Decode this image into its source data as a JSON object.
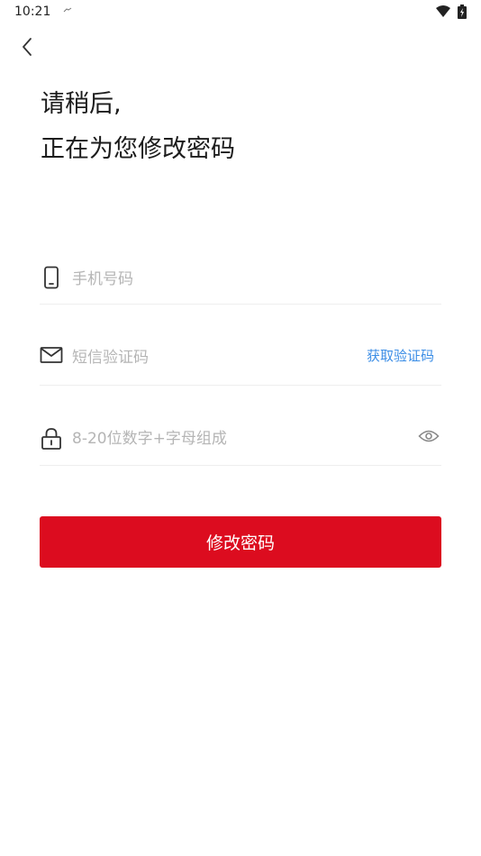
{
  "status_bar": {
    "time": "10:21"
  },
  "header": {
    "title_line1": "请稍后,",
    "title_line2": "正在为您修改密码"
  },
  "form": {
    "phone_placeholder": "手机号码",
    "sms_placeholder": "短信验证码",
    "get_code_label": "获取验证码",
    "password_placeholder": "8-20位数字+字母组成",
    "submit_label": "修改密码"
  },
  "colors": {
    "primary": "#dc0c1f",
    "link": "#3c8ee6",
    "placeholder": "#b5b5b5",
    "divider": "#eeeeee"
  },
  "icons": {
    "back": "chevron-left-icon",
    "phone": "phone-icon",
    "sms": "envelope-icon",
    "password": "lock-icon",
    "visibility": "eye-icon"
  }
}
